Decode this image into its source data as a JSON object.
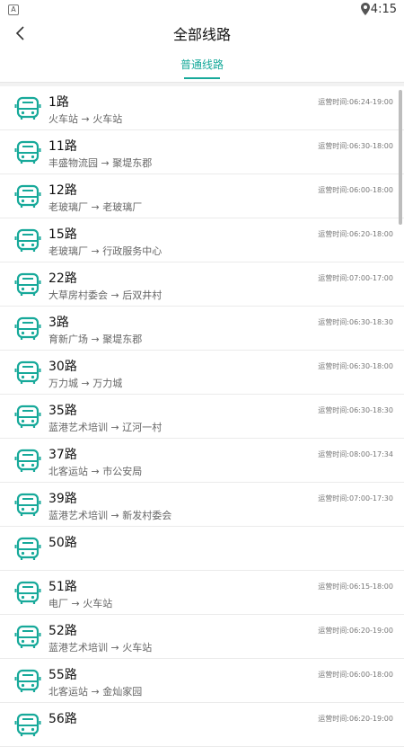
{
  "statusbar": {
    "time": "4:15",
    "app_icon": "A"
  },
  "header": {
    "title": "全部线路",
    "tab_label": "普通线路"
  },
  "colors": {
    "accent": "#17a99a"
  },
  "routes": [
    {
      "name": "1路",
      "path": "火车站 → 火车站",
      "time": "运营时间:06:24-19:00"
    },
    {
      "name": "11路",
      "path": "丰盛物流园 → 聚堤东郡",
      "time": "运营时间:06:30-18:00"
    },
    {
      "name": "12路",
      "path": "老玻璃厂 → 老玻璃厂",
      "time": "运营时间:06:00-18:00"
    },
    {
      "name": "15路",
      "path": "老玻璃厂 → 行政服务中心",
      "time": "运营时间:06:20-18:00"
    },
    {
      "name": "22路",
      "path": "大草房村委会 → 后双井村",
      "time": "运营时间:07:00-17:00"
    },
    {
      "name": "3路",
      "path": "育新广场 → 聚堤东郡",
      "time": "运营时间:06:30-18:30"
    },
    {
      "name": "30路",
      "path": "万力城 → 万力城",
      "time": "运营时间:06:30-18:00"
    },
    {
      "name": "35路",
      "path": "蓝港艺术培训 → 辽河一村",
      "time": "运营时间:06:30-18:30"
    },
    {
      "name": "37路",
      "path": "北客运站 → 市公安局",
      "time": "运营时间:08:00-17:34"
    },
    {
      "name": "39路",
      "path": "蓝港艺术培训 → 新发村委会",
      "time": "运营时间:07:00-17:30"
    },
    {
      "name": "50路",
      "path": "",
      "time": ""
    },
    {
      "name": "51路",
      "path": "电厂 → 火车站",
      "time": "运营时间:06:15-18:00"
    },
    {
      "name": "52路",
      "path": "蓝港艺术培训 → 火车站",
      "time": "运营时间:06:20-19:00"
    },
    {
      "name": "55路",
      "path": "北客运站 → 金灿家园",
      "time": "运营时间:06:00-18:00"
    },
    {
      "name": "56路",
      "path": "",
      "time": "运营时间:06:20-19:00"
    }
  ]
}
